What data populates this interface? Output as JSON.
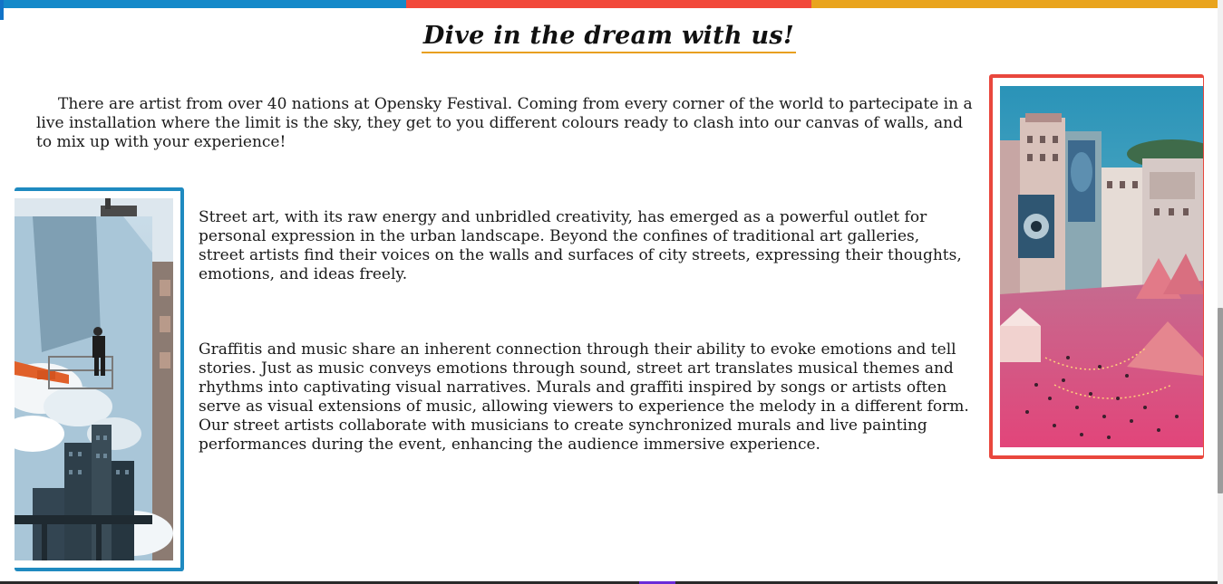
{
  "top_bar": {
    "colors": [
      "#1489c9",
      "#f2493a",
      "#e9a41d"
    ]
  },
  "heading": {
    "text": "Dive in the dream with us!",
    "underline_color": "#e8a020"
  },
  "intro": {
    "text": "There are artist from over 40 nations at Opensky Festival. Coming from every corner of the world to partecipate in a live installation where the limit is the sky, they get to you different colours ready to clash into our canvas of walls, and to mix up with your experience!"
  },
  "paragraphs": [
    {
      "text": "Street art, with its raw energy and unbridled creativity, has emerged as a powerful outlet for personal expression in the urban landscape. Beyond the confines of traditional art galleries, street artists find their voices on the walls and surfaces of city streets, expressing their thoughts, emotions, and ideas freely."
    },
    {
      "text": "Graffitis and music share an inherent connection through their ability to evoke emotions and tell stories. Just as music conveys emotions through sound, street art translates musical themes and rhythms into captivating visual narratives. Murals and graffiti inspired by songs or artists often serve as visual extensions of music, allowing viewers to experience the melody in a different form. Our street artists collaborate with musicians to create synchronized murals and live painting performances during the event, enhancing the audience immersive experience."
    }
  ],
  "images": {
    "left": {
      "frame_color": "#1f8ac0",
      "subject": "mural-painter-on-lift"
    },
    "right": {
      "frame_color": "#e9473d",
      "subject": "festival-square-at-dusk"
    }
  }
}
